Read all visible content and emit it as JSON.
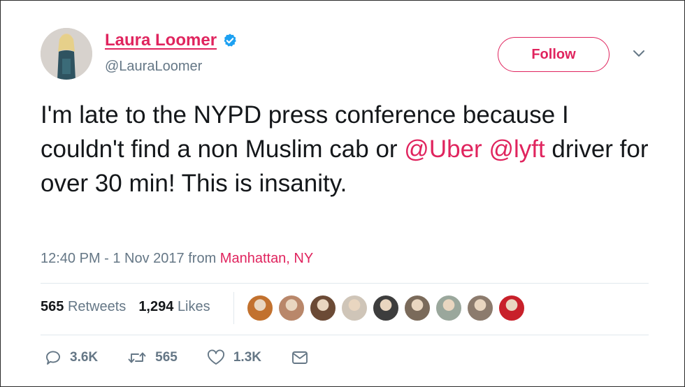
{
  "user": {
    "name": "Laura Loomer",
    "handle": "@LauraLoomer",
    "verified": true
  },
  "follow_button": {
    "label": "Follow"
  },
  "tweet": {
    "segments": [
      {
        "text": "I'm late to the NYPD press conference because I couldn't find a non Muslim cab or ",
        "type": "text"
      },
      {
        "text": "@Uber",
        "type": "mention"
      },
      {
        "text": " ",
        "type": "text"
      },
      {
        "text": "@lyft",
        "type": "mention"
      },
      {
        "text": " driver for over 30 min! This is insanity.",
        "type": "text"
      }
    ]
  },
  "meta": {
    "time": "12:40 PM - 1 Nov 2017 from ",
    "location": "Manhattan, NY"
  },
  "stats": {
    "retweets_count": "565",
    "retweets_label": "Retweets",
    "likes_count": "1,294",
    "likes_label": "Likes"
  },
  "likers": [
    {
      "name": "liker-1",
      "color": "#c2712e"
    },
    {
      "name": "liker-2",
      "color": "#b9876a"
    },
    {
      "name": "liker-3",
      "color": "#6b4a35"
    },
    {
      "name": "liker-4",
      "color": "#cfc5b8"
    },
    {
      "name": "liker-5",
      "color": "#3d3d3d"
    },
    {
      "name": "liker-6",
      "color": "#7a6a5a"
    },
    {
      "name": "liker-7",
      "color": "#9aa79c"
    },
    {
      "name": "liker-8",
      "color": "#8c7b6d"
    },
    {
      "name": "liker-9",
      "color": "#c8202a"
    }
  ],
  "actions": {
    "reply_count": "3.6K",
    "retweet_count": "565",
    "like_count": "1.3K"
  },
  "colors": {
    "accent": "#e0245e",
    "secondary_text": "#657786",
    "verified": "#1da1f2"
  },
  "icons": [
    "verified-badge-icon",
    "chevron-down-icon",
    "reply-icon",
    "retweet-icon",
    "like-icon",
    "message-icon"
  ]
}
